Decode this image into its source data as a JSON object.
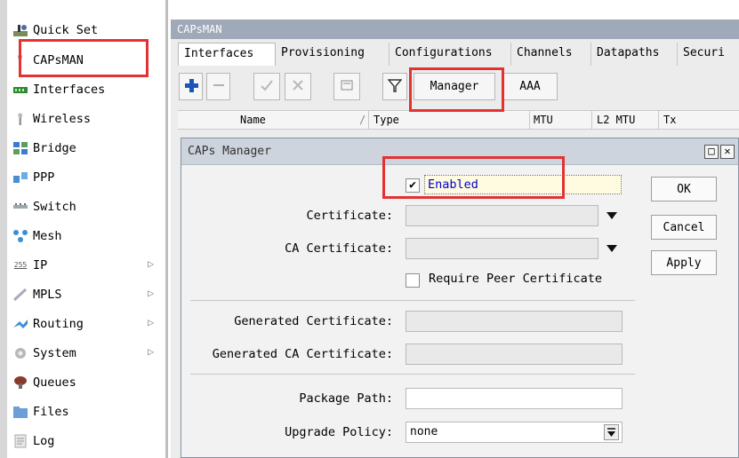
{
  "sidebar": {
    "items": [
      {
        "label": "Quick Set",
        "icon": "quick-set-icon"
      },
      {
        "label": "CAPsMAN",
        "icon": "capsman-icon"
      },
      {
        "label": "Interfaces",
        "icon": "interfaces-icon"
      },
      {
        "label": "Wireless",
        "icon": "wireless-icon"
      },
      {
        "label": "Bridge",
        "icon": "bridge-icon"
      },
      {
        "label": "PPP",
        "icon": "ppp-icon"
      },
      {
        "label": "Switch",
        "icon": "switch-icon"
      },
      {
        "label": "Mesh",
        "icon": "mesh-icon"
      },
      {
        "label": "IP",
        "icon": "ip-icon",
        "submenu": true
      },
      {
        "label": "MPLS",
        "icon": "mpls-icon",
        "submenu": true
      },
      {
        "label": "Routing",
        "icon": "routing-icon",
        "submenu": true
      },
      {
        "label": "System",
        "icon": "system-icon",
        "submenu": true
      },
      {
        "label": "Queues",
        "icon": "queues-icon"
      },
      {
        "label": "Files",
        "icon": "files-icon"
      },
      {
        "label": "Log",
        "icon": "log-icon"
      }
    ],
    "ip_icon_text": "255",
    "submenu_arrow": "▷"
  },
  "window": {
    "title": "CAPsMAN",
    "tabs": [
      "Interfaces",
      "Provisioning",
      "Configurations",
      "Channels",
      "Datapaths",
      "Securi"
    ],
    "toolbar": {
      "manager_label": "Manager",
      "aaa_label": "AAA"
    },
    "columns": {
      "name": "Name",
      "sort_glyph": "/",
      "type": "Type",
      "mtu": "MTU",
      "l2mtu": "L2 MTU",
      "tx": "Tx"
    }
  },
  "dialog": {
    "title": "CAPs Manager",
    "restore_glyph": "□",
    "close_glyph": "✕",
    "enabled_label": "Enabled",
    "enabled_checked": true,
    "certificate_label": "Certificate:",
    "certificate_value": "",
    "ca_certificate_label": "CA Certificate:",
    "ca_certificate_value": "",
    "require_peer_label": "Require Peer Certificate",
    "require_peer_checked": false,
    "generated_certificate_label": "Generated Certificate:",
    "generated_ca_certificate_label": "Generated CA Certificate:",
    "package_path_label": "Package Path:",
    "package_path_value": "",
    "upgrade_policy_label": "Upgrade Policy:",
    "upgrade_policy_value": "none",
    "buttons": {
      "ok": "OK",
      "cancel": "Cancel",
      "apply": "Apply"
    },
    "check_glyph": "✔"
  },
  "colors": {
    "highlight": "#e23232",
    "titlebar": "#9fa9b8",
    "dialog_title": "#ced4dd",
    "enabled_text": "#0000cc"
  }
}
